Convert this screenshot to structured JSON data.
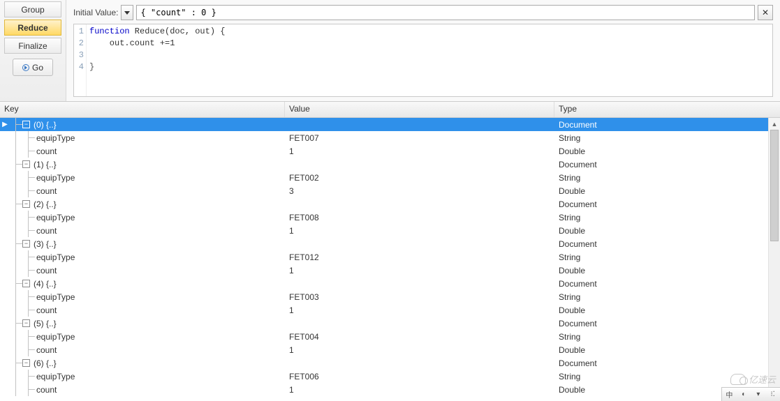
{
  "sidebar": {
    "tabs": [
      {
        "label": "Group"
      },
      {
        "label": "Reduce"
      },
      {
        "label": "Finalize"
      }
    ],
    "go_label": "Go"
  },
  "editor": {
    "initial_label": "Initial Value:",
    "initial_value": "{ \"count\" : 0 }",
    "clear_glyph": "✕",
    "code": {
      "l1a": "function",
      "l1b": " Reduce(doc, out) {",
      "l2": "    out.count +=1",
      "l3": "",
      "l4": "}"
    },
    "line_numbers": [
      "1",
      "2",
      "3",
      "4"
    ]
  },
  "tree": {
    "columns": {
      "key": "Key",
      "value": "Value",
      "type": "Type"
    },
    "type_document": "Document",
    "type_string": "String",
    "type_double": "Double",
    "rows": [
      {
        "kind": "doc",
        "selected": true,
        "label": "(0) {..}"
      },
      {
        "kind": "field",
        "key": "equipType",
        "value": "FET007",
        "vtype": "String"
      },
      {
        "kind": "field",
        "key": "count",
        "value": "1",
        "vtype": "Double"
      },
      {
        "kind": "doc",
        "selected": false,
        "label": "(1) {..}"
      },
      {
        "kind": "field",
        "key": "equipType",
        "value": "FET002",
        "vtype": "String"
      },
      {
        "kind": "field",
        "key": "count",
        "value": "3",
        "vtype": "Double"
      },
      {
        "kind": "doc",
        "selected": false,
        "label": "(2) {..}"
      },
      {
        "kind": "field",
        "key": "equipType",
        "value": "FET008",
        "vtype": "String"
      },
      {
        "kind": "field",
        "key": "count",
        "value": "1",
        "vtype": "Double"
      },
      {
        "kind": "doc",
        "selected": false,
        "label": "(3) {..}"
      },
      {
        "kind": "field",
        "key": "equipType",
        "value": "FET012",
        "vtype": "String"
      },
      {
        "kind": "field",
        "key": "count",
        "value": "1",
        "vtype": "Double"
      },
      {
        "kind": "doc",
        "selected": false,
        "label": "(4) {..}"
      },
      {
        "kind": "field",
        "key": "equipType",
        "value": "FET003",
        "vtype": "String"
      },
      {
        "kind": "field",
        "key": "count",
        "value": "1",
        "vtype": "Double"
      },
      {
        "kind": "doc",
        "selected": false,
        "label": "(5) {..}"
      },
      {
        "kind": "field",
        "key": "equipType",
        "value": "FET004",
        "vtype": "String"
      },
      {
        "kind": "field",
        "key": "count",
        "value": "1",
        "vtype": "Double"
      },
      {
        "kind": "doc",
        "selected": false,
        "label": "(6) {..}"
      },
      {
        "kind": "field",
        "key": "equipType",
        "value": "FET006",
        "vtype": "String"
      },
      {
        "kind": "field",
        "key": "count",
        "value": "1",
        "vtype": "Double"
      }
    ]
  },
  "watermark": "亿速云",
  "statusbar": {
    "a": "中",
    "b": "◐",
    "c": "▾",
    "d": "⁝⁚"
  }
}
